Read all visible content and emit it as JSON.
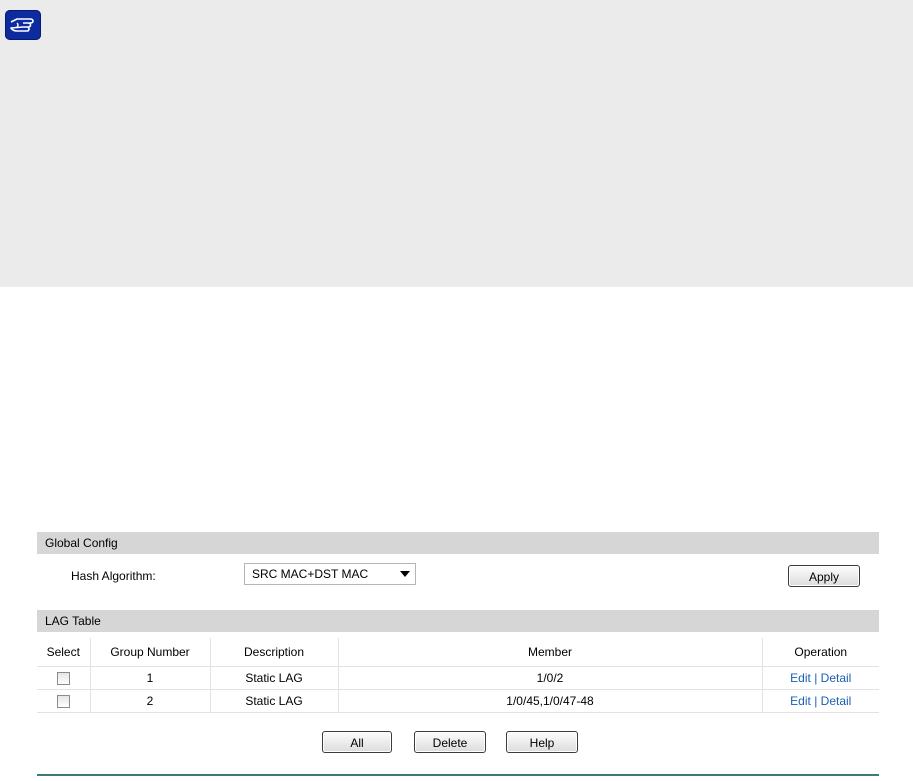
{
  "global_config": {
    "header": "Global Config",
    "hash_label": "Hash Algorithm:",
    "hash_value": "SRC MAC+DST MAC",
    "apply_label": "Apply"
  },
  "lag_table": {
    "header": "LAG Table",
    "columns": [
      "Select",
      "Group Number",
      "Description",
      "Member",
      "Operation"
    ],
    "rows": [
      {
        "group": "1",
        "description": "Static LAG",
        "member": "1/0/2",
        "edit": "Edit",
        "sep": "|",
        "detail": "Detail"
      },
      {
        "group": "2",
        "description": "Static LAG",
        "member": "1/0/45,1/0/47-48",
        "edit": "Edit",
        "sep": "|",
        "detail": "Detail"
      }
    ]
  },
  "buttons": {
    "all": "All",
    "delete": "Delete",
    "help": "Help"
  },
  "colors": {
    "note_icon": "#0d2b9e",
    "bar_bg": "#d6d6d6",
    "link": "#1a5fb4",
    "rule": "#3d7b7b"
  },
  "icons": {
    "note": "pointing-hand-icon",
    "dropdown": "triangle-down-icon"
  }
}
